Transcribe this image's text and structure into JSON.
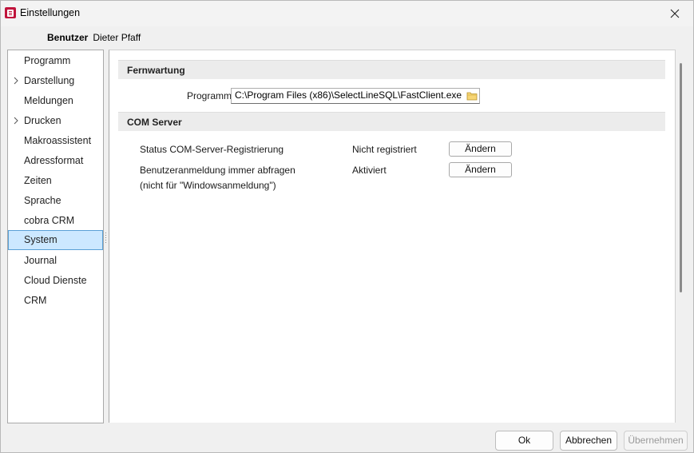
{
  "window": {
    "title": "Einstellungen"
  },
  "user": {
    "label": "Benutzer",
    "name": "Dieter Pfaff"
  },
  "sidebar": {
    "items": [
      {
        "label": "Programm",
        "expandable": false,
        "selected": false
      },
      {
        "label": "Darstellung",
        "expandable": true,
        "selected": false
      },
      {
        "label": "Meldungen",
        "expandable": false,
        "selected": false
      },
      {
        "label": "Drucken",
        "expandable": true,
        "selected": false
      },
      {
        "label": "Makroassistent",
        "expandable": false,
        "selected": false
      },
      {
        "label": "Adressformat",
        "expandable": false,
        "selected": false
      },
      {
        "label": "Zeiten",
        "expandable": false,
        "selected": false
      },
      {
        "label": "Sprache",
        "expandable": false,
        "selected": false
      },
      {
        "label": "cobra CRM",
        "expandable": false,
        "selected": false
      },
      {
        "label": "System",
        "expandable": false,
        "selected": true
      },
      {
        "label": "Journal",
        "expandable": false,
        "selected": false
      },
      {
        "label": "Cloud Dienste",
        "expandable": false,
        "selected": false
      },
      {
        "label": "CRM",
        "expandable": false,
        "selected": false
      }
    ]
  },
  "fernwartung": {
    "header": "Fernwartung",
    "program_label": "Programm",
    "program_path": "C:\\Program Files (x86)\\SelectLineSQL\\FastClient.exe"
  },
  "com_server": {
    "header": "COM Server",
    "rows": [
      {
        "label": "Status COM-Server-Registrierung",
        "status": "Nicht registriert",
        "button": "Ändern"
      },
      {
        "label": "Benutzeranmeldung immer abfragen",
        "sublabel": "(nicht für \"Windowsanmeldung\")",
        "status": "Aktiviert",
        "button": "Ändern"
      }
    ]
  },
  "footer": {
    "ok": "Ok",
    "cancel": "Abbrechen",
    "apply": "Übernehmen"
  },
  "colors": {
    "selection_bg": "#cce8ff",
    "selection_border": "#5aa0d6",
    "app_icon": "#c0143c"
  }
}
